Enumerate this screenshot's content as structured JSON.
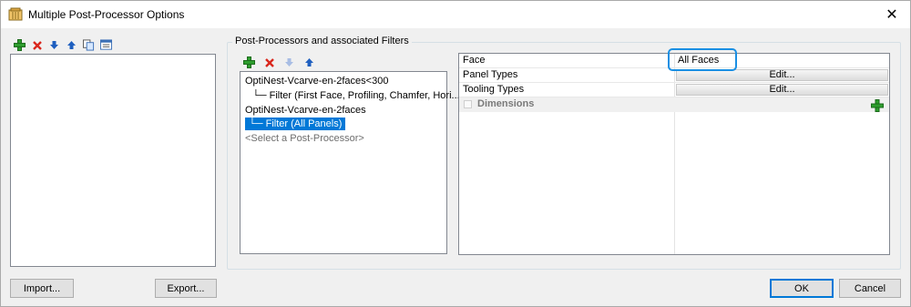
{
  "window": {
    "title": "Multiple Post-Processor Options",
    "close_glyph": "✕"
  },
  "left_toolbar": {
    "icons": [
      "add-icon",
      "delete-icon",
      "move-down-icon",
      "move-up-icon",
      "copy-icon",
      "properties-icon"
    ]
  },
  "group": {
    "label": "Post-Processors and associated Filters"
  },
  "tree_toolbar": {
    "icons": [
      "add-icon",
      "delete-icon",
      "move-down-icon",
      "move-up-icon"
    ]
  },
  "tree": {
    "items": [
      {
        "label": "OptiNest-Vcarve-en-2faces<300",
        "indent": 0,
        "selected": false,
        "muted": false
      },
      {
        "label": "└─ Filter (First Face, Profiling, Chamfer, Hori...",
        "indent": 1,
        "selected": false,
        "muted": false
      },
      {
        "label": "OptiNest-Vcarve-en-2faces",
        "indent": 0,
        "selected": false,
        "muted": false
      },
      {
        "label": "└─ Filter (All Panels)",
        "indent": 1,
        "selected": true,
        "muted": false
      },
      {
        "label": "<Select a Post-Processor>",
        "indent": 0,
        "selected": false,
        "muted": true
      }
    ]
  },
  "properties": {
    "face": {
      "name": "Face",
      "value": "All Faces"
    },
    "panel_types": {
      "name": "Panel Types",
      "value": "Edit..."
    },
    "tooling_types": {
      "name": "Tooling Types",
      "value": "Edit..."
    },
    "dimensions": {
      "name": "Dimensions"
    }
  },
  "buttons": {
    "import": "Import...",
    "export": "Export...",
    "ok": "OK",
    "cancel": "Cancel"
  },
  "colors": {
    "selection": "#0078d7",
    "highlight": "#1a8fe3",
    "add_green": "#2e9e2e",
    "delete_red": "#d9261c",
    "arrow_blue": "#1f5fbf"
  }
}
